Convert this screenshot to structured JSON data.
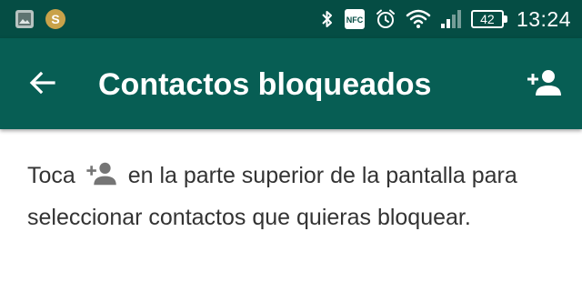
{
  "status_bar": {
    "time": "13:24",
    "battery_level": "42",
    "app_badge": "S",
    "icons": [
      "gallery-icon",
      "s-app-icon",
      "bluetooth-icon",
      "nfc-icon",
      "alarm-icon",
      "wifi-icon",
      "signal-icon",
      "battery-icon"
    ],
    "nfc_label": "NFC"
  },
  "toolbar": {
    "title": "Contactos bloqueados",
    "back_icon": "arrow-left-icon",
    "action_icon": "add-person-icon"
  },
  "content": {
    "text_before_icon": "Toca",
    "text_after_icon": "en la parte superior de la pantalla para seleccionar contactos que quieras bloquear.",
    "inline_icon": "add-person-icon"
  },
  "colors": {
    "status_bar_bg": "#054d44",
    "toolbar_bg": "#075e54",
    "text": "#333333",
    "icon_gray": "#757575"
  }
}
